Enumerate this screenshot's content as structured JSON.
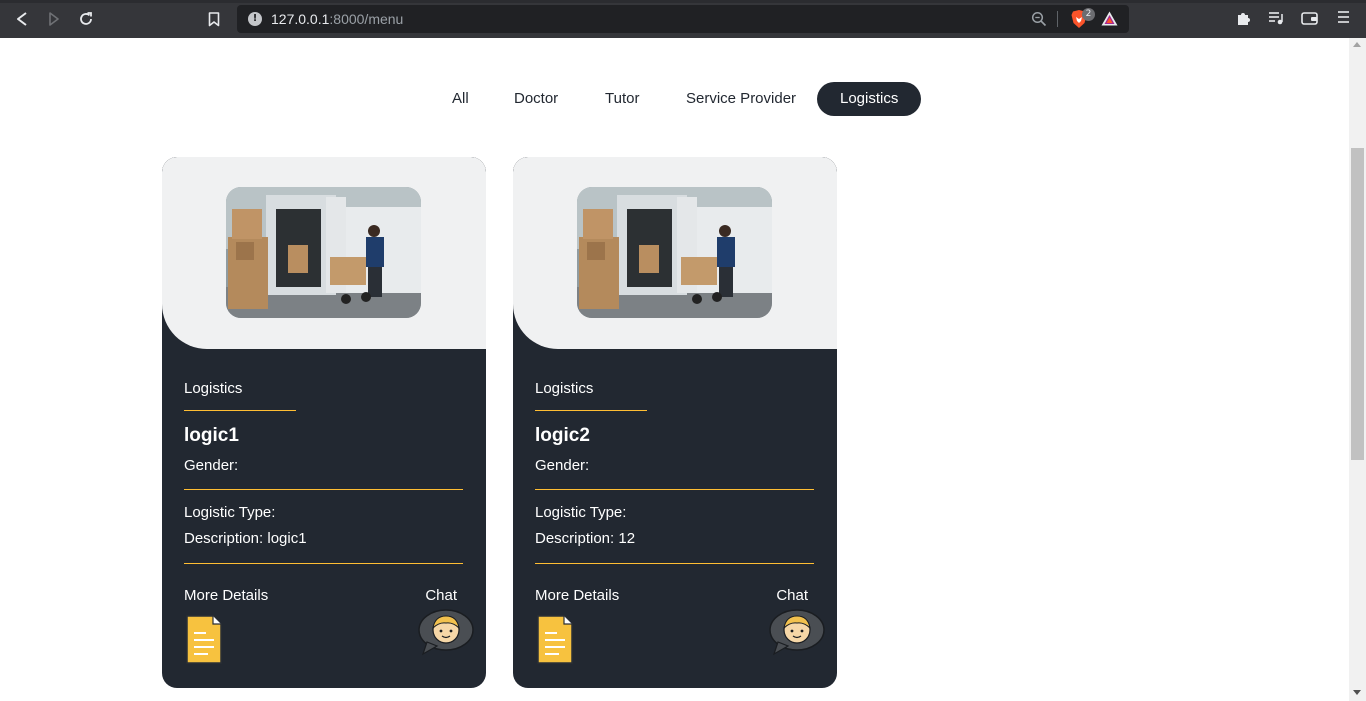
{
  "browser": {
    "url_host": "127.0.0.1",
    "url_path": ":8000/menu",
    "shields_badge": "2"
  },
  "filters": [
    {
      "label": "All",
      "active": false
    },
    {
      "label": "Doctor",
      "active": false
    },
    {
      "label": "Tutor",
      "active": false
    },
    {
      "label": "Service Provider",
      "active": false
    },
    {
      "label": "Logistics",
      "active": true
    }
  ],
  "cards": [
    {
      "category": "Logistics",
      "name": "logic1",
      "gender": "Gender:",
      "logistic_type": "Logistic Type:",
      "description": "Description: logic1",
      "more_details": "More Details",
      "chat": "Chat"
    },
    {
      "category": "Logistics",
      "name": "logic2",
      "gender": "Gender:",
      "logistic_type": "Logistic Type:",
      "description": "Description: 12",
      "more_details": "More Details",
      "chat": "Chat"
    }
  ],
  "colors": {
    "card_bg": "#222831",
    "accent": "#ffbe33",
    "active_filter_bg": "#222831",
    "card_top_bg": "#f0f1f2"
  },
  "icons": {
    "back": "back-icon",
    "forward": "forward-icon",
    "reload": "reload-icon",
    "bookmark": "bookmark-icon",
    "site_info": "info-icon",
    "zoom": "zoom-icon",
    "shields": "brave-shields-icon",
    "rewards": "brave-rewards-icon",
    "extensions": "puzzle-icon",
    "reading_list": "playlist-icon",
    "wallet": "wallet-icon",
    "menu": "hamburger-menu-icon",
    "document": "document-icon",
    "chat_avatar": "chat-avatar-icon"
  }
}
